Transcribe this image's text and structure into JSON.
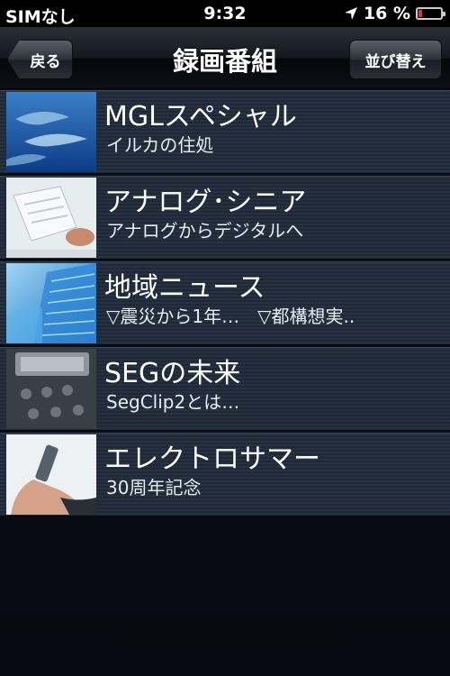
{
  "status_bar": {
    "carrier": "SIMなし",
    "time": "9:32",
    "battery_percent": "16 %",
    "battery_level": 0.16,
    "battery_color": "#e53030"
  },
  "nav_bar": {
    "title": "録画番組",
    "back_label": "戻る",
    "sort_label": "並び替え"
  },
  "programs": [
    {
      "title": "MGLスペシャル",
      "subtitle": "イルカの住処",
      "thumbnail": "dolphins-image"
    },
    {
      "title": "アナログ･シニア",
      "subtitle": "アナログからデジタルへ",
      "thumbnail": "laptop-image"
    },
    {
      "title": "地域ニュース",
      "subtitle": "▽震災から1年…　▽都構想実..",
      "thumbnail": "skyscraper-image"
    },
    {
      "title": "SEGの未来",
      "subtitle": "SegClip2とは…",
      "thumbnail": "remote-control-image"
    },
    {
      "title": "エレクトロサマー",
      "subtitle": "30周年記念",
      "thumbnail": "phone-hand-image"
    }
  ]
}
